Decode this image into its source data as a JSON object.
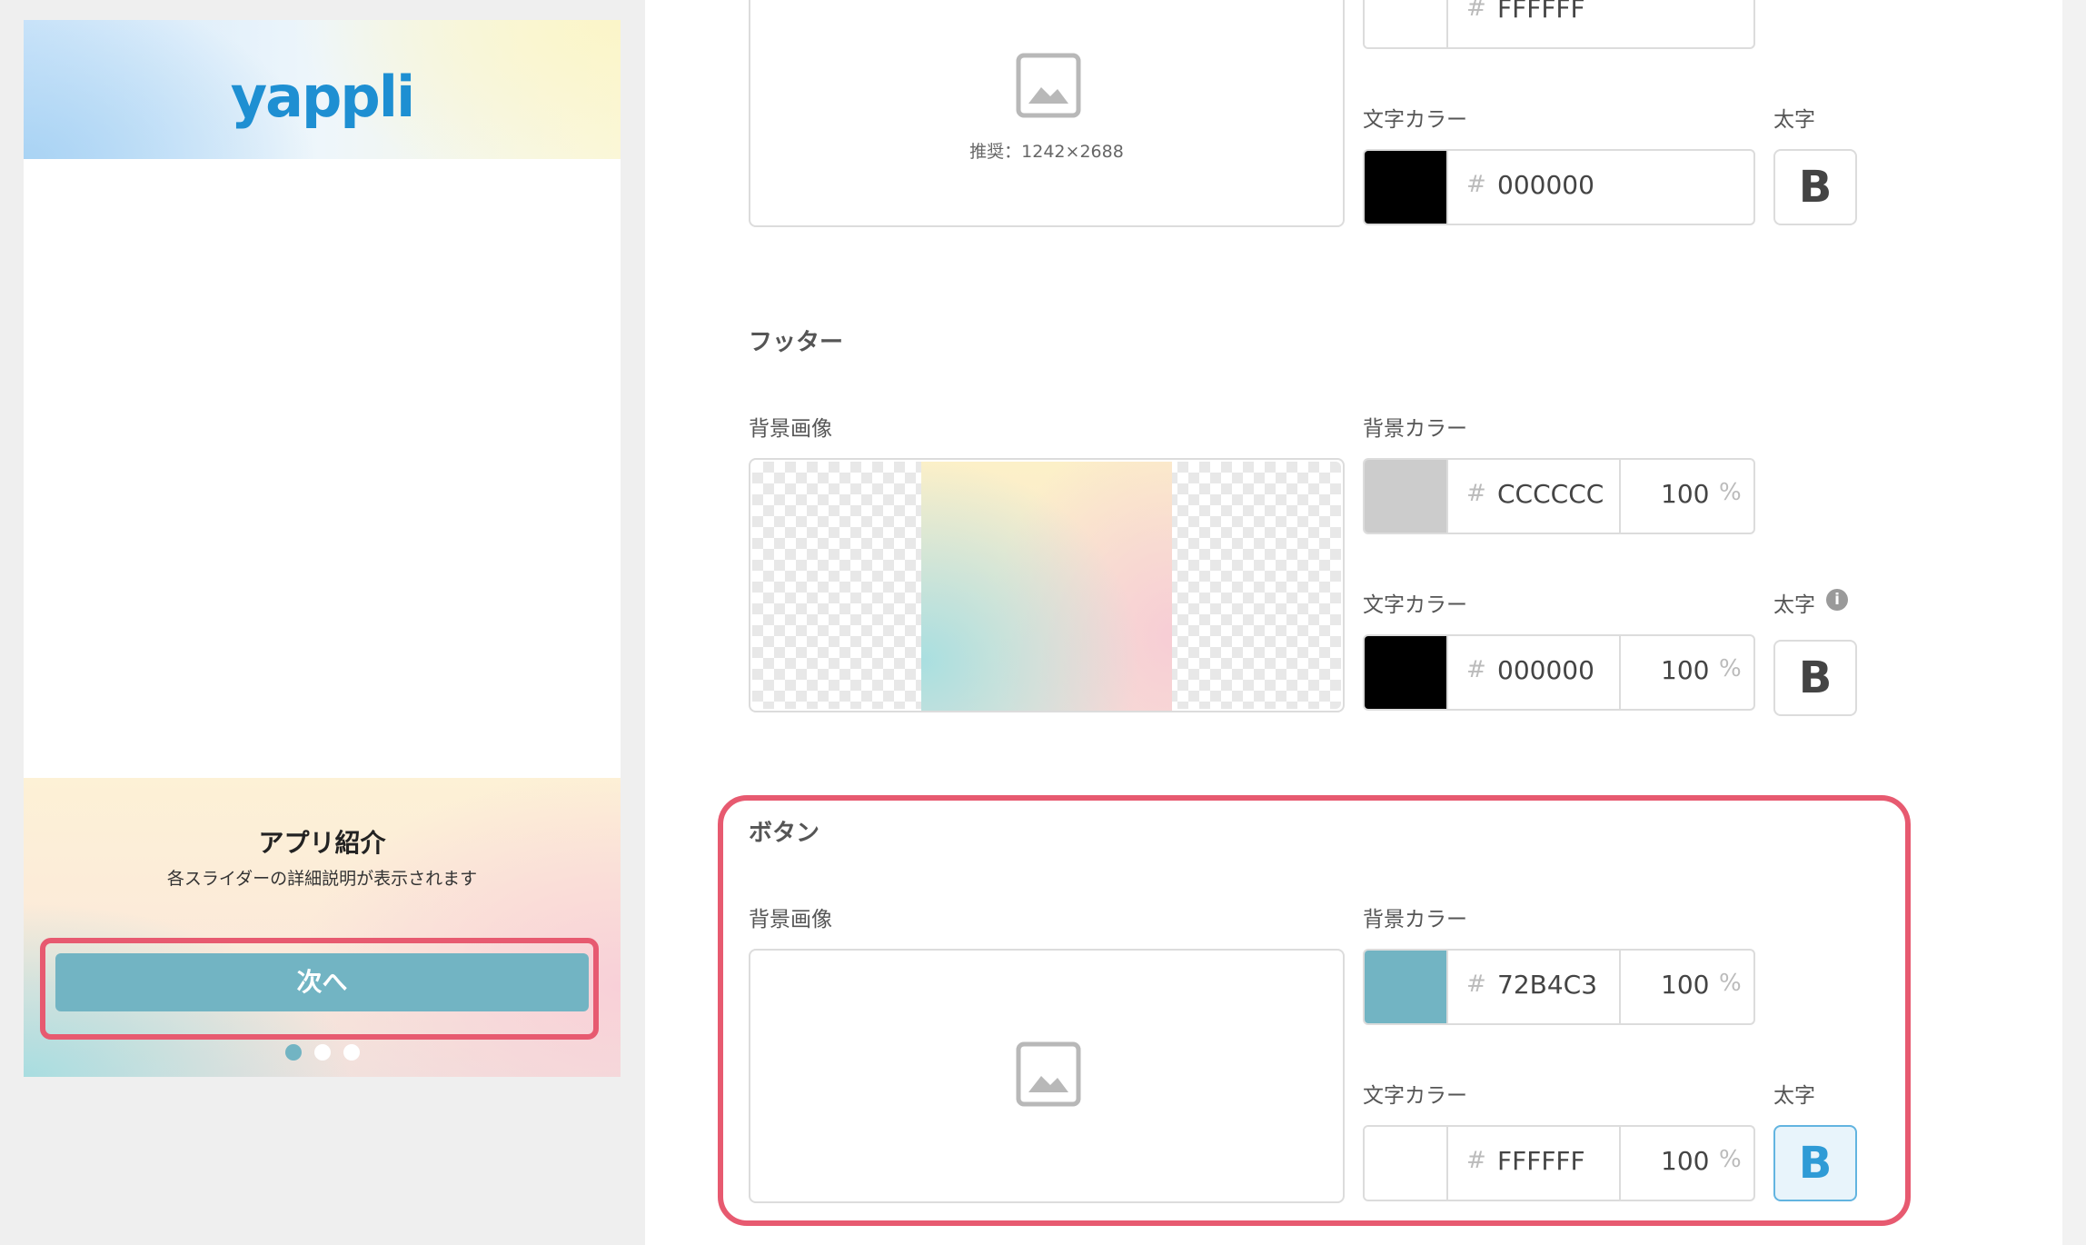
{
  "preview": {
    "logo_text": "yappli",
    "footer_title": "アプリ紹介",
    "footer_description": "各スライダーの詳細説明が表示されます",
    "next_button_label": "次へ"
  },
  "header_section": {
    "recommended_size": "推奨：1242×2688",
    "top_color": {
      "hex": "FFFFFF"
    },
    "text_color_label": "文字カラー",
    "text_color": {
      "hex": "000000",
      "swatch": "#000000"
    },
    "bold_label": "太字",
    "bold_glyph": "B"
  },
  "footer_section": {
    "title": "フッター",
    "bg_image_label": "背景画像",
    "bg_color_label": "背景カラー",
    "bg_color": {
      "hex": "CCCCCC",
      "opacity": "100",
      "pct": "%",
      "swatch": "#cccccc"
    },
    "text_color_label": "文字カラー",
    "text_color": {
      "hex": "000000",
      "opacity": "100",
      "pct": "%",
      "swatch": "#000000"
    },
    "bold_label": "太字",
    "info_glyph": "i",
    "bold_glyph": "B"
  },
  "button_section": {
    "title": "ボタン",
    "bg_image_label": "背景画像",
    "bg_color_label": "背景カラー",
    "bg_color": {
      "hex": "72B4C3",
      "opacity": "100",
      "pct": "%",
      "swatch": "#72b4c3"
    },
    "text_color_label": "文字カラー",
    "text_color": {
      "hex": "FFFFFF",
      "opacity": "100",
      "pct": "%",
      "swatch": "#ffffff"
    },
    "bold_label": "太字",
    "bold_glyph": "B",
    "bold_active": true
  },
  "hash_symbol": "#",
  "colors": {
    "highlight": "#e75a70",
    "accent": "#72b4c3",
    "bold_active": "#2f9bd6"
  }
}
